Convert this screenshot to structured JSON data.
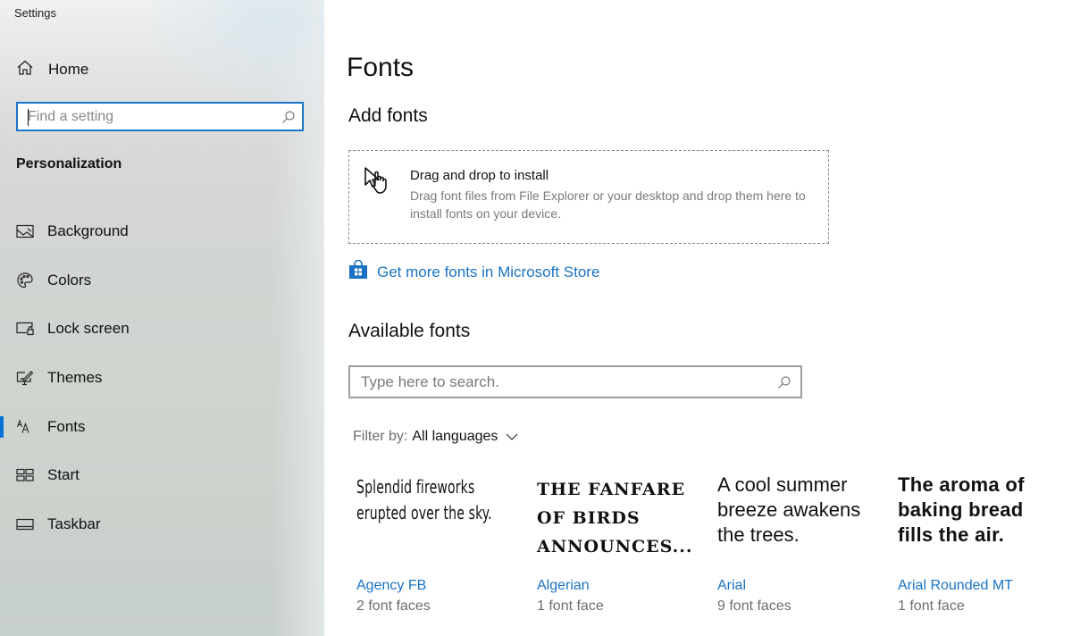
{
  "window": {
    "title": "Settings"
  },
  "sidebar": {
    "home_label": "Home",
    "search": {
      "placeholder": "Find a setting",
      "value": ""
    },
    "section_label": "Personalization",
    "items": [
      {
        "label": "Background",
        "icon": "picture-icon",
        "active": false
      },
      {
        "label": "Colors",
        "icon": "palette-icon",
        "active": false
      },
      {
        "label": "Lock screen",
        "icon": "lock-screen-icon",
        "active": false
      },
      {
        "label": "Themes",
        "icon": "themes-icon",
        "active": false
      },
      {
        "label": "Fonts",
        "icon": "fonts-icon",
        "active": true
      },
      {
        "label": "Start",
        "icon": "start-icon",
        "active": false
      },
      {
        "label": "Taskbar",
        "icon": "taskbar-icon",
        "active": false
      }
    ],
    "accent_color": "#0a72d6"
  },
  "main": {
    "title": "Fonts",
    "add_fonts": {
      "heading": "Add fonts",
      "dropzone_title": "Drag and drop to install",
      "dropzone_desc": "Drag font files from File Explorer or your desktop and drop them here to install fonts on your device.",
      "store_link": "Get more fonts in Microsoft Store"
    },
    "available_fonts": {
      "heading": "Available fonts",
      "search": {
        "placeholder": "Type here to search.",
        "value": ""
      },
      "filter_label": "Filter by:",
      "filter_value": "All languages",
      "fonts": [
        {
          "sample": "Splendid fireworks erupted over the sky.",
          "name": "Agency FB",
          "faces": "2 font faces"
        },
        {
          "sample": "The fanfare of birds announces...",
          "name": "Algerian",
          "faces": "1 font face"
        },
        {
          "sample": "A cool summer breeze awakens the trees.",
          "name": "Arial",
          "faces": "9 font faces"
        },
        {
          "sample": "The aroma of baking bread fills the air.",
          "name": "Arial Rounded MT",
          "faces": "1 font face"
        }
      ]
    },
    "link_color": "#1a73c4"
  }
}
